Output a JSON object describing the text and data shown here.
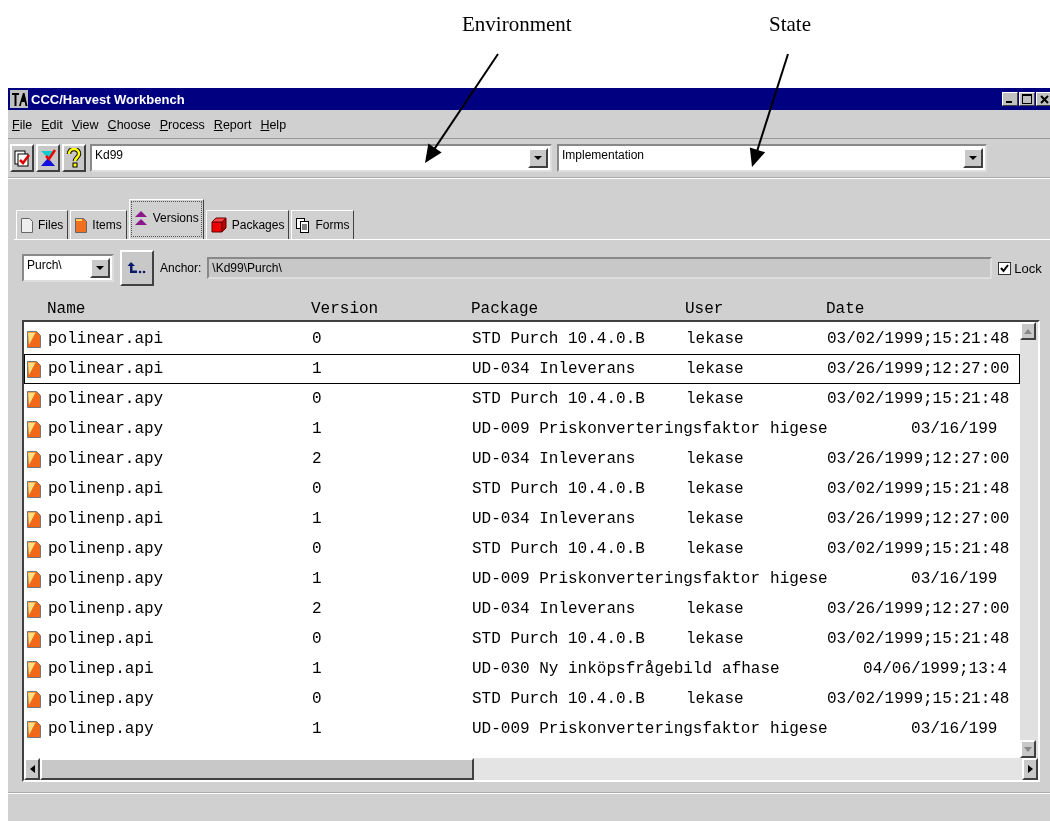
{
  "annotations": [
    {
      "label": "Environment"
    },
    {
      "label": "State"
    }
  ],
  "window": {
    "title": "CCC/Harvest Workbench"
  },
  "menu": [
    "File",
    "Edit",
    "View",
    "Choose",
    "Process",
    "Report",
    "Help"
  ],
  "toolbar": {
    "environment": "Kd99",
    "state": "Implementation"
  },
  "tabs": [
    {
      "label": "Files",
      "selected": false
    },
    {
      "label": "Items",
      "selected": false
    },
    {
      "label": "Versions",
      "selected": true
    },
    {
      "label": "Packages",
      "selected": false
    },
    {
      "label": "Forms",
      "selected": false
    }
  ],
  "view_path": "Purch\\",
  "anchor": {
    "label": "Anchor:",
    "value": "\\Kd99\\Purch\\"
  },
  "lock": {
    "label": "Lock",
    "checked": true
  },
  "columns": [
    "Name",
    "Version",
    "Package",
    "User",
    "Date"
  ],
  "rows": [
    {
      "name": "polinear.api",
      "version": "0",
      "package": "STD Purch 10.4.0.B",
      "user": "lekase",
      "date": "03/02/1999;15:21:48",
      "selected": false
    },
    {
      "name": "polinear.api",
      "version": "1",
      "package": "UD-034 Inleverans",
      "user": "lekase",
      "date": "03/26/1999;12:27:00",
      "selected": true
    },
    {
      "name": "polinear.apy",
      "version": "0",
      "package": "STD Purch 10.4.0.B",
      "user": "lekase",
      "date": "03/02/1999;15:21:48",
      "selected": false
    },
    {
      "name": "polinear.apy",
      "version": "1",
      "package": "UD-009 Priskonverteringsfaktor",
      "user": "higese",
      "date": "03/16/199",
      "selected": false
    },
    {
      "name": "polinear.apy",
      "version": "2",
      "package": "UD-034 Inleverans",
      "user": "lekase",
      "date": "03/26/1999;12:27:00",
      "selected": false
    },
    {
      "name": "polinenp.api",
      "version": "0",
      "package": "STD Purch 10.4.0.B",
      "user": "lekase",
      "date": "03/02/1999;15:21:48",
      "selected": false
    },
    {
      "name": "polinenp.api",
      "version": "1",
      "package": "UD-034 Inleverans",
      "user": "lekase",
      "date": "03/26/1999;12:27:00",
      "selected": false
    },
    {
      "name": "polinenp.apy",
      "version": "0",
      "package": "STD Purch 10.4.0.B",
      "user": "lekase",
      "date": "03/02/1999;15:21:48",
      "selected": false
    },
    {
      "name": "polinenp.apy",
      "version": "1",
      "package": "UD-009 Priskonverteringsfaktor",
      "user": "higese",
      "date": "03/16/199",
      "selected": false
    },
    {
      "name": "polinenp.apy",
      "version": "2",
      "package": "UD-034 Inleverans",
      "user": "lekase",
      "date": "03/26/1999;12:27:00",
      "selected": false
    },
    {
      "name": "polinep.api",
      "version": "0",
      "package": "STD Purch 10.4.0.B",
      "user": "lekase",
      "date": "03/02/1999;15:21:48",
      "selected": false
    },
    {
      "name": "polinep.api",
      "version": "1",
      "package": "UD-030 Ny inköpsfrågebild",
      "user": "afhase",
      "date": "04/06/1999;13:4",
      "selected": false
    },
    {
      "name": "polinep.apy",
      "version": "0",
      "package": "STD Purch 10.4.0.B",
      "user": "lekase",
      "date": "03/02/1999;15:21:48",
      "selected": false
    },
    {
      "name": "polinep.apy",
      "version": "1",
      "package": "UD-009 Priskonverteringsfaktor",
      "user": "higese",
      "date": "03/16/199",
      "selected": false
    }
  ]
}
